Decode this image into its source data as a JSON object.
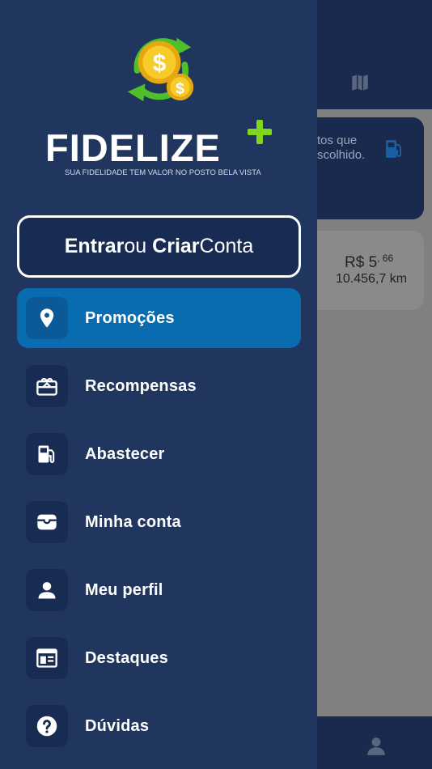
{
  "brand": {
    "name": "FIDELIZE",
    "tagline": "SUA FIDELIDADE TEM VALOR NO POSTO BELA VISTA"
  },
  "login": {
    "part1": "Entrar",
    "part2": "ou",
    "part3": "Criar",
    "part4": "Conta"
  },
  "menu": {
    "items": [
      {
        "label": "Promoções",
        "icon": "location-pin-icon",
        "active": true
      },
      {
        "label": "Recompensas",
        "icon": "gift-card-icon",
        "active": false
      },
      {
        "label": "Abastecer",
        "icon": "fuel-pump-icon",
        "active": false
      },
      {
        "label": "Minha conta",
        "icon": "wallet-icon",
        "active": false
      },
      {
        "label": "Meu perfil",
        "icon": "person-icon",
        "active": false
      },
      {
        "label": "Destaques",
        "icon": "newspaper-icon",
        "active": false
      },
      {
        "label": "Dúvidas",
        "icon": "help-icon",
        "active": false
      }
    ]
  },
  "background": {
    "card_text_line1": "tos que",
    "card_text_line2": "scolhido.",
    "price_main": "R$ 5",
    "price_cents": ", 66",
    "distance": "10.456,7 km"
  },
  "colors": {
    "drawer": "#21365f",
    "active_item": "#0a6cb0",
    "icon_box": "#182b52",
    "accent_green": "#7fd81e",
    "coin_gold": "#f5c518"
  }
}
